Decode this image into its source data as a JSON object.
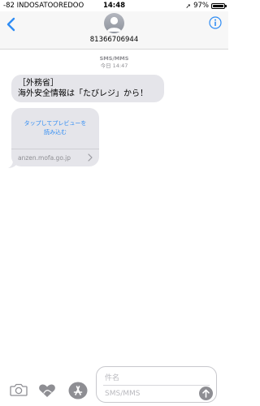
{
  "status": {
    "carrier": "-82 INDOSATOOREDOO",
    "time": "14:48",
    "battery": "97%",
    "battery_level": 0.97
  },
  "header": {
    "contact": "81366706944"
  },
  "conversation": {
    "service_label": "SMS/MMS",
    "timestamp": "今日 14:47",
    "message_lines": [
      "［外務省］",
      "海外安全情報は「たびレジ」から！"
    ],
    "preview_lines": [
      "タップしてプレビューを",
      "読み込む"
    ],
    "link_domain": "anzen.mofa.go.jp"
  },
  "input": {
    "subject_placeholder": "件名",
    "message_placeholder": "SMS/MMS"
  },
  "colors": {
    "accent": "#2f8cf4",
    "bubble": "#e5e5ea"
  },
  "icons": [
    "back-chevron-icon",
    "avatar-icon",
    "info-icon",
    "camera-icon",
    "digital-touch-heart-icon",
    "app-store-icon",
    "send-arrow-icon",
    "chevron-right-icon"
  ]
}
